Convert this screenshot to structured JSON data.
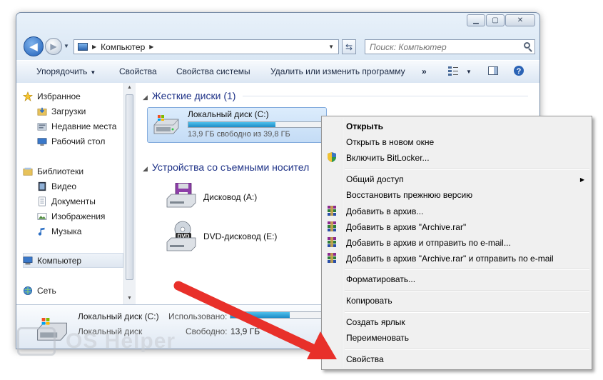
{
  "address": {
    "segment": "Компьютер"
  },
  "search": {
    "placeholder": "Поиск: Компьютер"
  },
  "toolbar": {
    "organize": "Упорядочить",
    "properties": "Свойства",
    "system_properties": "Свойства системы",
    "uninstall": "Удалить или изменить программу",
    "more": "»"
  },
  "nav": {
    "favorites": "Избранное",
    "downloads": "Загрузки",
    "recent": "Недавние места",
    "desktop": "Рабочий стол",
    "libraries": "Библиотеки",
    "video": "Видео",
    "documents": "Документы",
    "images": "Изображения",
    "music": "Музыка",
    "computer": "Компьютер",
    "network": "Сеть"
  },
  "content": {
    "hdd_group": "Жесткие диски (1)",
    "local_disk": "Локальный диск (C:)",
    "local_disk_free": "13,9 ГБ свободно из 39,8 ГБ",
    "local_disk_usage_fraction": 0.65,
    "removable_group": "Устройства со съемными носител",
    "floppy": "Дисковод (A:)",
    "dvd": "DVD-дисковод (E:)",
    "dvd_label": "DVD"
  },
  "details": {
    "name": "Локальный диск (C:)",
    "type": "Локальный диск",
    "used_label": "Использовано:",
    "free_label": "Свободно:",
    "free_value": "13,9 ГБ",
    "usage_fraction": 0.65
  },
  "context_menu": {
    "open": "Открыть",
    "open_new_window": "Открыть в новом окне",
    "bitlocker": "Включить BitLocker...",
    "share": "Общий доступ",
    "restore": "Восстановить прежнюю версию",
    "add_archive": "Добавить в архив...",
    "add_archive_rar": "Добавить в архив \"Archive.rar\"",
    "add_archive_email": "Добавить в архив и отправить по e-mail...",
    "add_archive_rar_email": "Добавить в архив \"Archive.rar\" и отправить по e-mail",
    "format": "Форматировать...",
    "copy": "Копировать",
    "create_shortcut": "Создать ярлык",
    "rename": "Переименовать",
    "properties": "Свойства"
  },
  "watermark": {
    "text": "OS Helper"
  },
  "colors": {
    "arrow": "#e8302a",
    "progress": "#1d8bc6",
    "group_header": "#1e3287"
  }
}
